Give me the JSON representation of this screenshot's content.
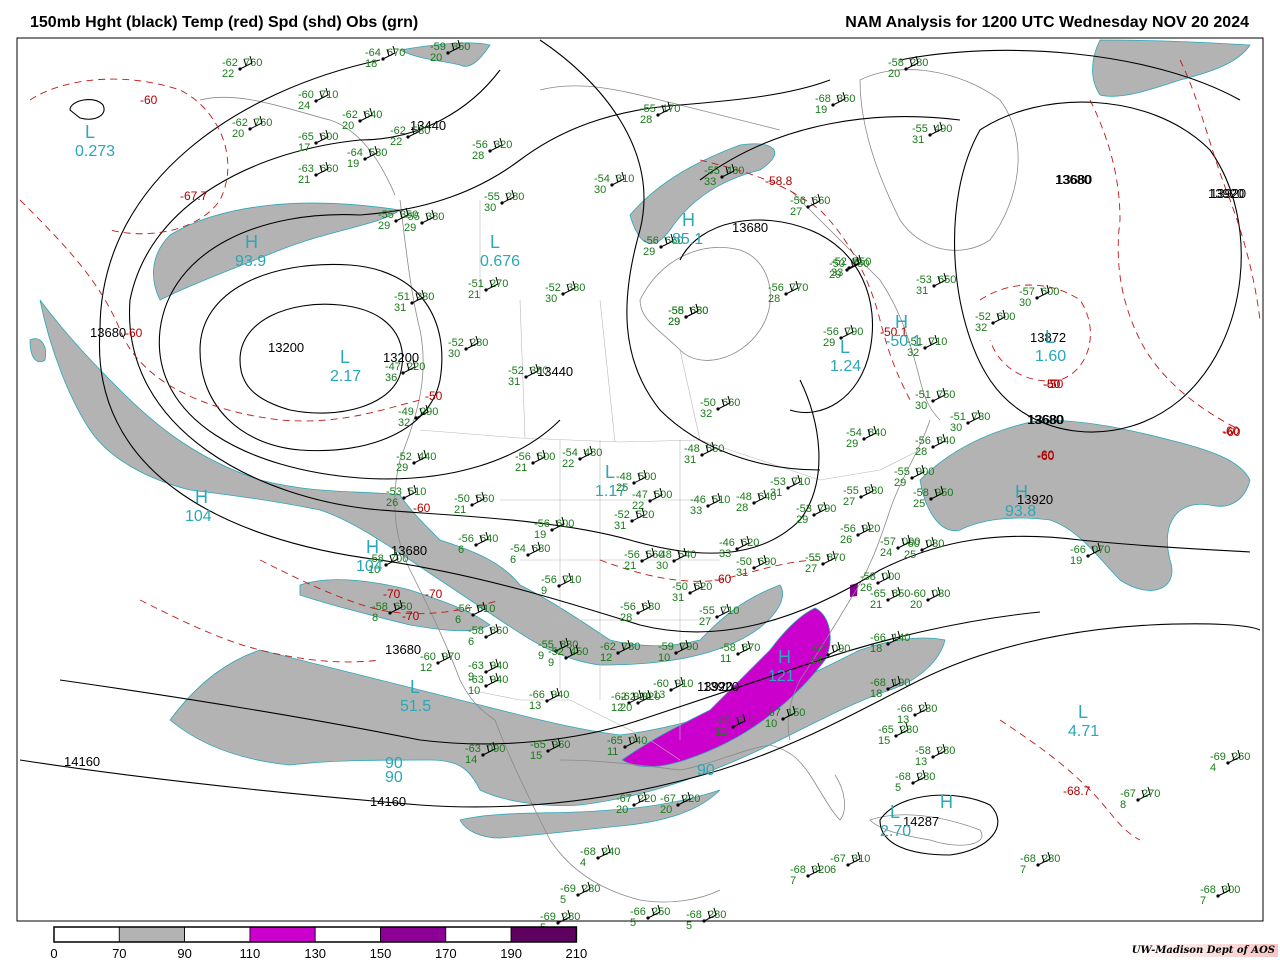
{
  "header": {
    "left_title": "150mb Hght (black) Temp (red) Spd (shd) Obs (grn)",
    "right_title": "NAM Analysis for 1200 UTC Wednesday  NOV 20 2024"
  },
  "height_labels": [
    "13680",
    "13200",
    "13440",
    "13200",
    "13440",
    "13680",
    "13680",
    "13680",
    "13920",
    "13680",
    "13920",
    "13680",
    "13920",
    "13872",
    "13920",
    "13680",
    "14160",
    "14160",
    "14287",
    "13920",
    "13680"
  ],
  "temperature_labels": [
    "-60",
    "-67.7",
    "-60",
    "-60",
    "-50",
    "-50",
    "-60",
    "-70",
    "-70",
    "-70",
    "-58.8",
    "-50.1",
    "-60",
    "-50",
    "-60",
    "-60",
    "-50",
    "-60",
    "-68.7"
  ],
  "centers": [
    {
      "letter": "L",
      "value": "0.273"
    },
    {
      "letter": "H",
      "value": "93.9"
    },
    {
      "letter": "L",
      "value": "0.676"
    },
    {
      "letter": "H",
      "value": "85.1"
    },
    {
      "letter": "L",
      "value": "2.17"
    },
    {
      "letter": "L",
      "value": "1.24"
    },
    {
      "letter": "H",
      "value": "-50.1"
    },
    {
      "letter": "L",
      "value": "1.60"
    },
    {
      "letter": "H",
      "value": "104"
    },
    {
      "letter": "L",
      "value": "1.17"
    },
    {
      "letter": "H",
      "value": "104"
    },
    {
      "letter": "H",
      "value": "93.8"
    },
    {
      "letter": "L",
      "value": "51.5"
    },
    {
      "letter": "H",
      "value": "121"
    },
    {
      "letter": "L",
      "value": "4.71"
    },
    {
      "letter": "L",
      "value": "2.70"
    },
    {
      "letter": "H",
      "value": ""
    }
  ],
  "extra_values": [
    "90",
    "90",
    "90"
  ],
  "observations": [
    [
      "-62",
      "22",
      "760"
    ],
    [
      "-64",
      "18",
      "670"
    ],
    [
      "-59",
      "20",
      "350"
    ],
    [
      "-60",
      "24",
      "710"
    ],
    [
      "-62",
      "20",
      "640"
    ],
    [
      "-62",
      "20",
      "760"
    ],
    [
      "-65",
      "17",
      "600"
    ],
    [
      "-62",
      "22",
      "530"
    ],
    [
      "-64",
      "19",
      "580"
    ],
    [
      "-63",
      "21",
      "660"
    ],
    [
      "-56",
      "28",
      "320"
    ],
    [
      "-55",
      "29",
      "350"
    ],
    [
      "-55",
      "30",
      "280"
    ],
    [
      "-55",
      "29",
      "380"
    ],
    [
      "-54",
      "30",
      "310"
    ],
    [
      "-55",
      "28",
      "170"
    ],
    [
      "-51",
      "21",
      "270"
    ],
    [
      "-52",
      "30",
      "380"
    ],
    [
      "-51",
      "31",
      "230"
    ],
    [
      "-52",
      "30",
      "280"
    ],
    [
      "-47",
      "36",
      "220"
    ],
    [
      "-52",
      "31",
      "380"
    ],
    [
      "-49",
      "32",
      "290"
    ],
    [
      "-52",
      "29",
      "440"
    ],
    [
      "-53",
      "26",
      "510"
    ],
    [
      "-56",
      "21",
      "500"
    ],
    [
      "-54",
      "22",
      "480"
    ],
    [
      "-50",
      "21",
      "560"
    ],
    [
      "-48",
      "25",
      "500"
    ],
    [
      "-47",
      "22",
      "500"
    ],
    [
      "-52",
      "31",
      "520"
    ],
    [
      "-56",
      "19",
      "600"
    ],
    [
      "-48",
      "31",
      "560"
    ],
    [
      "-50",
      "32",
      "660"
    ],
    [
      "-46",
      "33",
      "510"
    ],
    [
      "-48",
      "28",
      "640"
    ],
    [
      "-53",
      "31",
      "710"
    ],
    [
      "-53",
      "29",
      "790"
    ],
    [
      "-56",
      "27",
      "660"
    ],
    [
      "-58",
      "29",
      "680"
    ],
    [
      "-55",
      "33",
      "480"
    ],
    [
      "-56",
      "29",
      "660"
    ],
    [
      "-55",
      "29",
      "680"
    ],
    [
      "-56",
      "28",
      "770"
    ],
    [
      "-52",
      "33",
      "750"
    ],
    [
      "-56",
      "29",
      "790"
    ],
    [
      "-51",
      "32",
      "710"
    ],
    [
      "-53",
      "31",
      "650"
    ],
    [
      "-52",
      "32",
      "600"
    ],
    [
      "-57",
      "30",
      "600"
    ],
    [
      "-58",
      "20",
      "280"
    ],
    [
      "-68",
      "19",
      "360"
    ],
    [
      "-55",
      "31",
      "490"
    ],
    [
      "-51",
      "30",
      "750"
    ],
    [
      "-51",
      "30",
      "730"
    ],
    [
      "-54",
      "29",
      "840"
    ],
    [
      "-56",
      "28",
      "840"
    ],
    [
      "-55",
      "29",
      "900"
    ],
    [
      "-58",
      "25",
      "950"
    ],
    [
      "-55",
      "27",
      "380"
    ],
    [
      "-56",
      "26",
      "920"
    ],
    [
      "-60",
      "25",
      "030"
    ],
    [
      "-66",
      "19",
      "070"
    ],
    [
      "-58",
      "26",
      "000"
    ],
    [
      "-55",
      "27",
      "870"
    ],
    [
      "-57",
      "24",
      "000"
    ],
    [
      "-65",
      "21",
      "850"
    ],
    [
      "-60",
      "20",
      "030"
    ],
    [
      "-46",
      "33",
      "620"
    ],
    [
      "-50",
      "31",
      "690"
    ],
    [
      "-48",
      "30",
      "540"
    ],
    [
      "-50",
      "31",
      "620"
    ],
    [
      "-56",
      "28",
      "680"
    ],
    [
      "-55",
      "27",
      "710"
    ],
    [
      "-56",
      "21",
      "560"
    ],
    [
      "-58",
      "10",
      "700"
    ],
    [
      "-56",
      "6",
      "640"
    ],
    [
      "-54",
      "6",
      "680"
    ],
    [
      "-56",
      "9",
      "710"
    ],
    [
      "-56",
      "6",
      "810"
    ],
    [
      "-58",
      "6",
      "860"
    ],
    [
      "-58",
      "8",
      "650"
    ],
    [
      "-55",
      "9",
      "830"
    ],
    [
      "-62",
      "12",
      "780"
    ],
    [
      "-59",
      "10",
      "790"
    ],
    [
      "-58",
      "11",
      "870"
    ],
    [
      "-60",
      "13",
      "910"
    ],
    [
      "-62",
      "12",
      "920"
    ],
    [
      "-66",
      "13",
      "940"
    ],
    [
      "-63",
      "10",
      "940"
    ],
    [
      "-63",
      "9",
      "940"
    ],
    [
      "-60",
      "12",
      "970"
    ],
    [
      "-62",
      "20",
      "920"
    ],
    [
      "-65",
      "15",
      "960"
    ],
    [
      "-63",
      "14",
      "090"
    ],
    [
      "-65",
      "11",
      "040"
    ],
    [
      "-65",
      "12",
      "110"
    ],
    [
      "-67",
      "10",
      "150"
    ],
    [
      "-62",
      "14",
      "090"
    ],
    [
      "-66",
      "18",
      "140"
    ],
    [
      "-68",
      "18",
      "190"
    ],
    [
      "-66",
      "13",
      "230"
    ],
    [
      "-65",
      "15",
      "230"
    ],
    [
      "-58",
      "13",
      "280"
    ],
    [
      "-68",
      "5",
      "280"
    ],
    [
      "-67",
      "20",
      "220"
    ],
    [
      "-67",
      "20",
      "220"
    ],
    [
      "-69",
      "4",
      "260"
    ],
    [
      "-67",
      "8",
      "270"
    ],
    [
      "-68",
      "4",
      "240"
    ],
    [
      "-67",
      "6",
      "310"
    ],
    [
      "-68",
      "7",
      "320"
    ],
    [
      "-68",
      "7",
      "280"
    ],
    [
      "-69",
      "5",
      "280"
    ],
    [
      "-69",
      "5",
      "280"
    ],
    [
      "-66",
      "5",
      "250"
    ],
    [
      "-68",
      "5",
      "280"
    ],
    [
      "-68",
      "7",
      "300"
    ],
    [
      "-52",
      "9",
      "450"
    ],
    [
      "-50",
      "29",
      "750"
    ]
  ],
  "colorbar": {
    "ticks": [
      "0",
      "70",
      "90",
      "110",
      "130",
      "150",
      "170",
      "190",
      "210"
    ],
    "colors": [
      "#ffffff",
      "#b3b3b3",
      "#ffffff",
      "#cc00cc",
      "#ffffff",
      "#8c0096",
      "#ffffff",
      "#5e0060"
    ]
  },
  "credit": "UW-Madison  Dept of AOS"
}
